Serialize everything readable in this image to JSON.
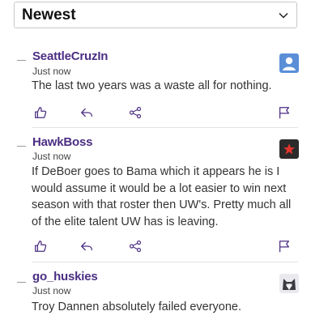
{
  "sort": {
    "selected": "Newest"
  },
  "colors": {
    "accent": "#4b2e83",
    "icon": "#4b2e83"
  },
  "comments": [
    {
      "author": "SeattleCruzIn",
      "time": "Just now",
      "text": "The last two years was a waste all for nothing.",
      "avatar_icon": "person-avatar-icon"
    },
    {
      "author": "HawkBoss",
      "time": "Just now",
      "text": "If DeBoer goes to Bama which it appears he is I would assume it would be a lot easier to win next season with that roster then UW's. Pretty much all of the elite talent UW has is leaving.",
      "avatar_icon": "star-avatar-icon"
    },
    {
      "author": "go_huskies",
      "time": "Just now",
      "text": "Troy Dannen absolutely failed everyone.",
      "avatar_icon": "husky-avatar-icon"
    }
  ],
  "actions": [
    "like-icon",
    "reply-icon",
    "share-icon",
    "report-flag-icon"
  ]
}
